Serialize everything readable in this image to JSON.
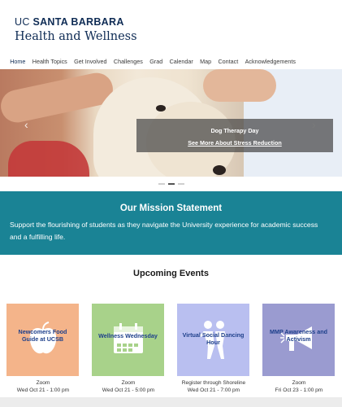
{
  "header": {
    "logo_uc": "UC",
    "logo_sb": "SANTA BARBARA",
    "logo_sub": "Health and Wellness"
  },
  "nav": {
    "items": [
      {
        "label": "Home"
      },
      {
        "label": "Health Topics"
      },
      {
        "label": "Get Involved"
      },
      {
        "label": "Challenges"
      },
      {
        "label": "Grad"
      },
      {
        "label": "Calendar"
      },
      {
        "label": "Map"
      },
      {
        "label": "Contact"
      },
      {
        "label": "Acknowledgements"
      }
    ],
    "active": "Home"
  },
  "hero": {
    "caption_title": "Dog Therapy Day",
    "caption_link": "See More About Stress Reduction",
    "prev_icon": "chevron-left-icon",
    "next_icon": "chevron-right-icon",
    "slide_count": 3,
    "active_slide": 2
  },
  "mission": {
    "title": "Our Mission Statement",
    "text": "Support the flourishing of students as they navigate the University experience for academic success and a fulfilling life."
  },
  "events": {
    "title": "Upcoming Events",
    "items": [
      {
        "title": "Newcomers Food Guide at UCSB",
        "location": "Zoom",
        "date": "Wed Oct 21 - 1:00 pm",
        "bg": "#f4b48a",
        "icon": "apple-icon"
      },
      {
        "title": "Wellness Wednesday",
        "location": "Zoom",
        "date": "Wed Oct 21 - 5:00 pm",
        "bg": "#a8d28a",
        "icon": "calendar-icon"
      },
      {
        "title": "Virtual Social Dancing Hour",
        "location": "Register through Shoreline",
        "date": "Wed Oct 21 - 7:00 pm",
        "bg": "#b9bff0",
        "icon": "dancers-icon"
      },
      {
        "title": "MMP Awareness and Activism",
        "location": "Zoom",
        "date": "Fri Oct 23 - 1:00 pm",
        "bg": "#9a9bd0",
        "icon": "megaphone-icon"
      }
    ]
  },
  "colors": {
    "brand_navy": "#0f2c55",
    "mission_teal": "#1a8395"
  }
}
